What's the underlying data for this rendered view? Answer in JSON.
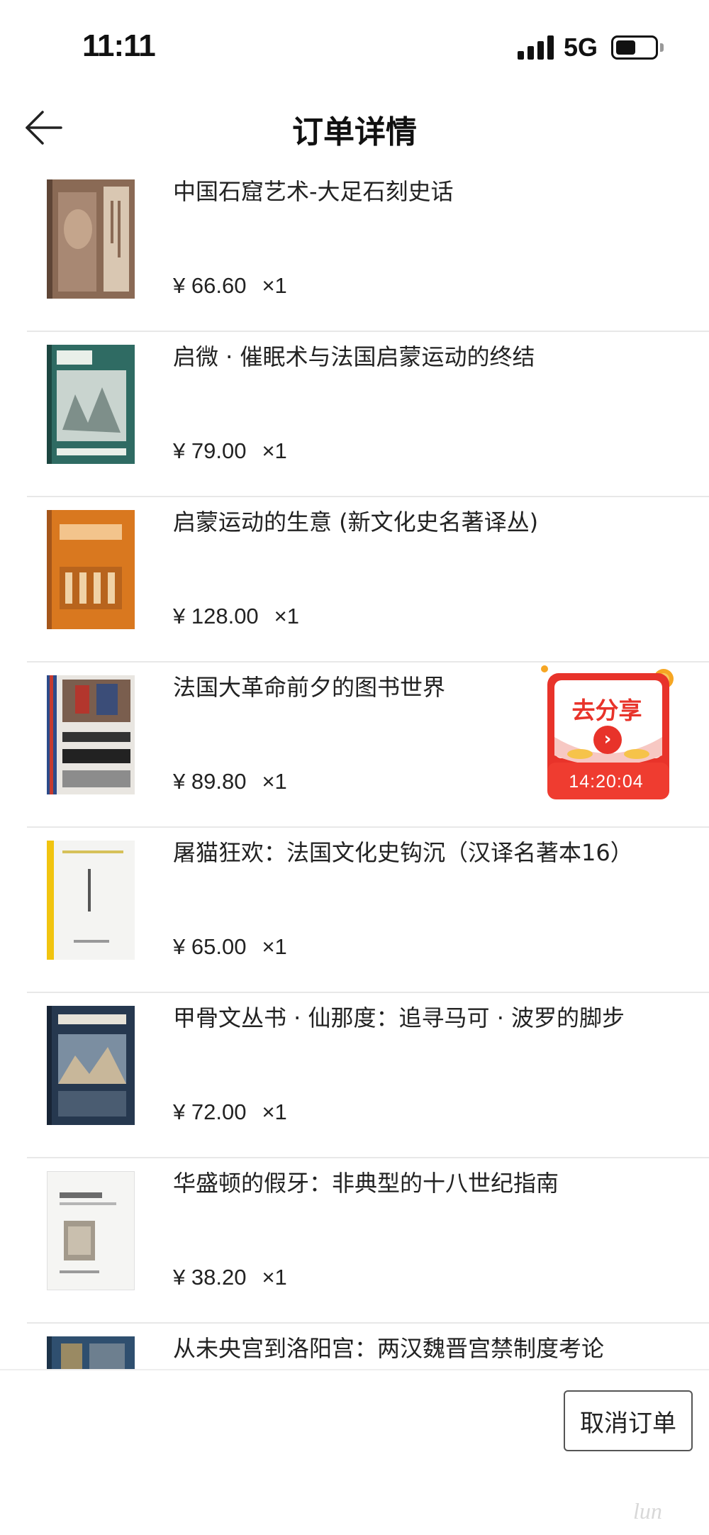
{
  "status_bar": {
    "time": "11:11",
    "network": "5G"
  },
  "nav": {
    "title": "订单详情"
  },
  "items": [
    {
      "title": "中国石窟艺术-大足石刻史话",
      "price": "¥ 66.60",
      "qty": "×1"
    },
    {
      "title": "启微 · 催眠术与法国启蒙运动的终结",
      "price": "¥ 79.00",
      "qty": "×1"
    },
    {
      "title": "启蒙运动的生意 (新文化史名著译丛)",
      "price": "¥ 128.00",
      "qty": "×1"
    },
    {
      "title": "法国大革命前夕的图书世界",
      "price": "¥ 89.80",
      "qty": "×1"
    },
    {
      "title": "屠猫狂欢：法国文化史钩沉（汉译名著本16）",
      "price": "¥ 65.00",
      "qty": "×1"
    },
    {
      "title": "甲骨文丛书 · 仙那度：追寻马可 · 波罗的脚步",
      "price": "¥ 72.00",
      "qty": "×1"
    },
    {
      "title": "华盛顿的假牙：非典型的十八世纪指南",
      "price": "¥ 38.20",
      "qty": "×1"
    },
    {
      "title": "从未央宫到洛阳宫：两汉魏晋宫禁制度考论",
      "price": "",
      "qty": ""
    }
  ],
  "share_badge": {
    "label": "去分享",
    "countdown": "14:20:04"
  },
  "bottom": {
    "cancel_label": "取消订单"
  },
  "watermark": {
    "text": "lun"
  },
  "colors": {
    "accent_red": "#e8332a",
    "divider": "#e8e8e8"
  }
}
